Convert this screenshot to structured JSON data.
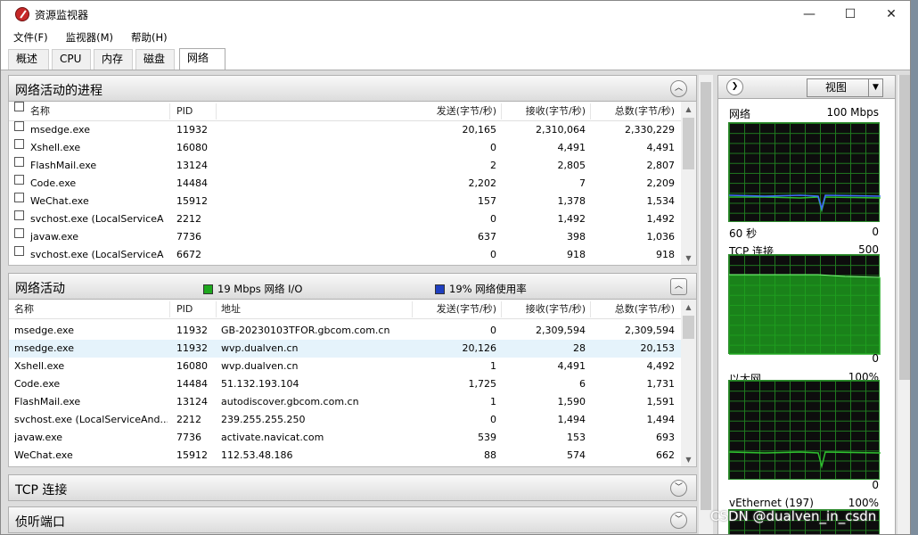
{
  "window": {
    "title": "资源监视器",
    "minimize": "—",
    "maximize": "☐",
    "close": "✕"
  },
  "menu": [
    "文件(F)",
    "监视器(M)",
    "帮助(H)"
  ],
  "tabs": [
    "概述",
    "CPU",
    "内存",
    "磁盘",
    "网络"
  ],
  "active_tab": "网络",
  "processes": {
    "title": "网络活动的进程",
    "columns": {
      "name": "名称",
      "pid": "PID",
      "send": "发送(字节/秒)",
      "recv": "接收(字节/秒)",
      "total": "总数(字节/秒)"
    },
    "rows": [
      {
        "name": "msedge.exe",
        "pid": "11932",
        "send": "20,165",
        "recv": "2,310,064",
        "total": "2,330,229"
      },
      {
        "name": "Xshell.exe",
        "pid": "16080",
        "send": "0",
        "recv": "4,491",
        "total": "4,491"
      },
      {
        "name": "FlashMail.exe",
        "pid": "13124",
        "send": "2",
        "recv": "2,805",
        "total": "2,807"
      },
      {
        "name": "Code.exe",
        "pid": "14484",
        "send": "2,202",
        "recv": "7",
        "total": "2,209"
      },
      {
        "name": "WeChat.exe",
        "pid": "15912",
        "send": "157",
        "recv": "1,378",
        "total": "1,534"
      },
      {
        "name": "svchost.exe (LocalServiceA...",
        "pid": "2212",
        "send": "0",
        "recv": "1,492",
        "total": "1,492"
      },
      {
        "name": "javaw.exe",
        "pid": "7736",
        "send": "637",
        "recv": "398",
        "total": "1,036"
      },
      {
        "name": "svchost.exe (LocalServiceA...",
        "pid": "6672",
        "send": "0",
        "recv": "918",
        "total": "918"
      }
    ]
  },
  "activity": {
    "title": "网络活动",
    "io_legend": "19 Mbps 网络 I/O",
    "io_color": "#1fa81f",
    "usage_legend": "19% 网络使用率",
    "usage_color": "#1f3fbf",
    "columns": {
      "name": "名称",
      "pid": "PID",
      "address": "地址",
      "send": "发送(字节/秒)",
      "recv": "接收(字节/秒)",
      "total": "总数(字节/秒)"
    },
    "rows": [
      {
        "name": "msedge.exe",
        "pid": "11932",
        "address": "GB-20230103TFOR.gbcom.com.cn",
        "send": "0",
        "recv": "2,309,594",
        "total": "2,309,594"
      },
      {
        "name": "msedge.exe",
        "pid": "11932",
        "address": "wvp.dualven.cn",
        "send": "20,126",
        "recv": "28",
        "total": "20,153"
      },
      {
        "name": "Xshell.exe",
        "pid": "16080",
        "address": "wvp.dualven.cn",
        "send": "1",
        "recv": "4,491",
        "total": "4,492"
      },
      {
        "name": "Code.exe",
        "pid": "14484",
        "address": "51.132.193.104",
        "send": "1,725",
        "recv": "6",
        "total": "1,731"
      },
      {
        "name": "FlashMail.exe",
        "pid": "13124",
        "address": "autodiscover.gbcom.com.cn",
        "send": "1",
        "recv": "1,590",
        "total": "1,591"
      },
      {
        "name": "svchost.exe (LocalServiceAnd...",
        "pid": "2212",
        "address": "239.255.255.250",
        "send": "0",
        "recv": "1,494",
        "total": "1,494"
      },
      {
        "name": "javaw.exe",
        "pid": "7736",
        "address": "activate.navicat.com",
        "send": "539",
        "recv": "153",
        "total": "693"
      },
      {
        "name": "WeChat.exe",
        "pid": "15912",
        "address": "112.53.48.186",
        "send": "88",
        "recv": "574",
        "total": "662"
      }
    ]
  },
  "tcp_section": {
    "title": "TCP 连接"
  },
  "ports_section": {
    "title": "侦听端口"
  },
  "right_panel": {
    "view_button": "视图",
    "graphs": [
      {
        "label": "网络",
        "right": "100 Mbps",
        "bottom_left": "60 秒",
        "bottom_right": "0"
      },
      {
        "label": "TCP 连接",
        "right": "500",
        "bottom_left": "",
        "bottom_right": "0"
      },
      {
        "label": "以太网",
        "right": "100%",
        "bottom_left": "",
        "bottom_right": "0"
      },
      {
        "label": "vEthernet (197)",
        "right": "100%",
        "bottom_left": "",
        "bottom_right": ""
      }
    ]
  },
  "watermark": "CSDN @dualven_in_csdn"
}
